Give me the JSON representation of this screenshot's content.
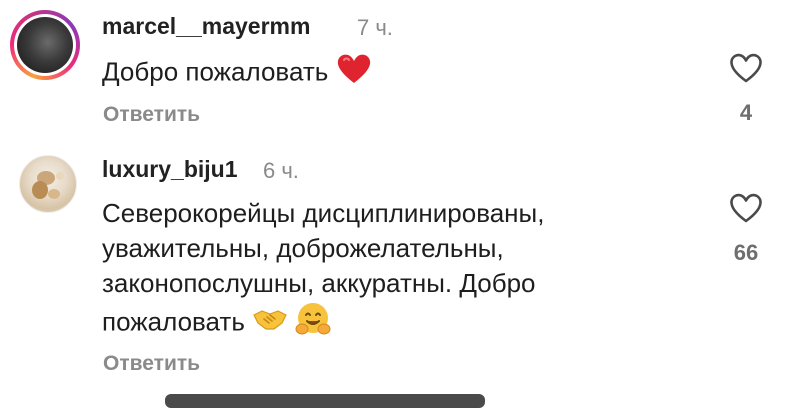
{
  "comments": [
    {
      "username": "marcel__mayermm",
      "time": "7 ч.",
      "text": "Добро пожаловать",
      "emoji": "red-heart",
      "reply_label": "Ответить",
      "likes": "4"
    },
    {
      "username": "luxury_biju1",
      "time": "6 ч.",
      "text_lines": [
        "Северокорейцы дисциплинированы,",
        "уважительны,  доброжелательны,",
        "законопослушны, аккуратны. Добро",
        "пожаловать"
      ],
      "emojis": [
        "handshake",
        "hugging-face"
      ],
      "reply_label": "Ответить",
      "likes": "66"
    }
  ],
  "colors": {
    "meta_gray": "#8a8a8a",
    "heart_red": "#e0242f",
    "hug_yellow": "#f7c23c"
  }
}
